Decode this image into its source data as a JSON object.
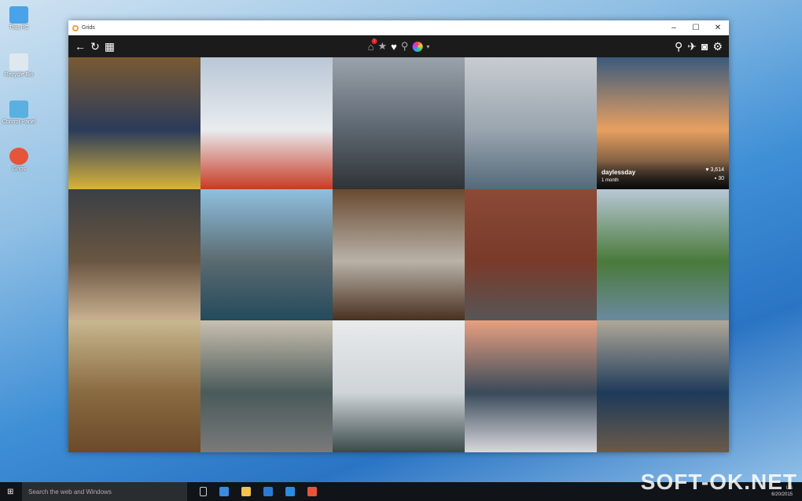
{
  "desktop": {
    "icons": [
      {
        "label": "This PC",
        "color": "#4aa3e8"
      },
      {
        "label": "Recycle Bin",
        "color": "#dfe8ef"
      },
      {
        "label": "Control Panel",
        "color": "#5ab0e0"
      },
      {
        "label": "Grids",
        "color": "#e6553a"
      }
    ]
  },
  "window": {
    "title": "Grids",
    "controls": [
      "–",
      "☐",
      "✕"
    ]
  },
  "toolbar": {
    "left": [
      "←",
      "↻",
      "▦"
    ],
    "center": {
      "home_badge": "1",
      "icons": [
        "home-icon",
        "star-icon",
        "heart-icon",
        "location-icon",
        "account-icon"
      ],
      "glyphs": [
        "⌂",
        "★",
        "♥",
        "⚲"
      ],
      "dropdown": "▾"
    },
    "right": [
      "⚲",
      "✈",
      "◙",
      "⚙"
    ]
  },
  "grid": {
    "tiles": [
      {
        "colors": [
          "#7a5a32",
          "#2b3b5a",
          "#d8b43c"
        ]
      },
      {
        "colors": [
          "#b9c7d6",
          "#e9ecef",
          "#c83a25"
        ]
      },
      {
        "colors": [
          "#9aa2ab",
          "#5c6670",
          "#2f3336"
        ]
      },
      {
        "colors": [
          "#c8ccd1",
          "#9aa5ae",
          "#546a7a"
        ]
      },
      {
        "colors": [
          "#3b5a7c",
          "#e8a060",
          "#2a2a2a"
        ],
        "overlay": {
          "user": "daylessday",
          "time": "1 month",
          "likes": "3,614",
          "comments": "30"
        }
      },
      {
        "colors": [
          "#3b3f44",
          "#6a5642",
          "#c9b090"
        ]
      },
      {
        "colors": [
          "#8fc0e0",
          "#5a6a70",
          "#234a5c"
        ]
      },
      {
        "colors": [
          "#6a4a30",
          "#b8b2a8",
          "#4a3020"
        ]
      },
      {
        "colors": [
          "#8a4a36",
          "#7a3a2a",
          "#565656"
        ]
      },
      {
        "colors": [
          "#b8c8d6",
          "#4a7a3a",
          "#6a8aa0"
        ]
      },
      {
        "colors": [
          "#c8b890",
          "#8a6a40",
          "#6a4a2a"
        ]
      },
      {
        "colors": [
          "#c9c0b0",
          "#4a5a5a",
          "#7a7a7a"
        ]
      },
      {
        "colors": [
          "#e8eaec",
          "#cfd4d8",
          "#3a4a4a"
        ]
      },
      {
        "colors": [
          "#e8a080",
          "#3a4a5a",
          "#d8d8dc"
        ]
      },
      {
        "colors": [
          "#b0a898",
          "#1e3a5a",
          "#6a5a4a"
        ]
      }
    ]
  },
  "taskbar": {
    "search_placeholder": "Search the web and Windows",
    "lang": "US",
    "date": "6/20/2015",
    "apps": [
      "#3c8be0",
      "#f2c14e",
      "#2b7bd6",
      "#2a8de0",
      "#e6553a"
    ]
  },
  "watermark": "SOFT-OK.NET"
}
